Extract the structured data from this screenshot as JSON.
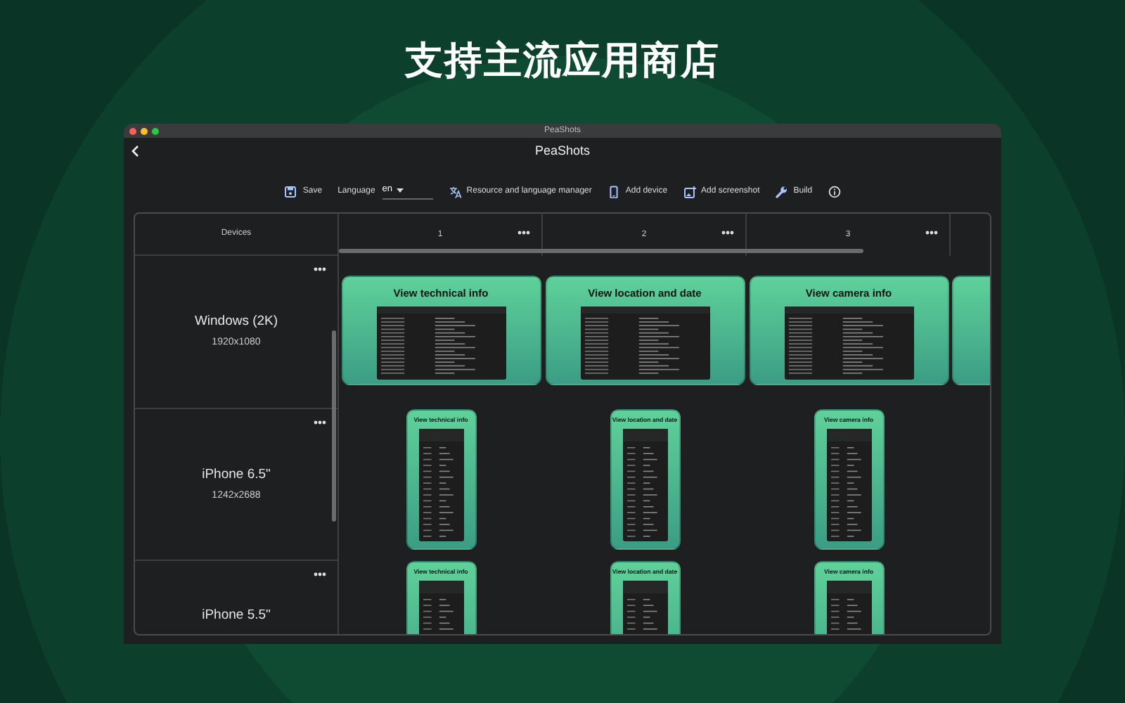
{
  "headline": "支持主流应用商店",
  "window": {
    "title": "PeaShots"
  },
  "header": {
    "title": "PeaShots"
  },
  "toolbar": [
    {
      "kind": "button",
      "label": "Save"
    },
    {
      "kind": "select",
      "label": "Language",
      "value": "en"
    },
    {
      "kind": "button",
      "label": "Resource and language manager"
    },
    {
      "kind": "button",
      "label": "Add device"
    },
    {
      "kind": "button",
      "label": "Add screenshot"
    },
    {
      "kind": "button",
      "label": "Build"
    },
    {
      "kind": "info"
    }
  ],
  "grid": {
    "corner": "Devices",
    "columns": [
      "1",
      "2",
      "3"
    ],
    "rows": [
      {
        "name": "Windows (2K)",
        "resolution": "1920x1080",
        "kind": "landscape",
        "shots": [
          "View technical info",
          "View location and date",
          "View camera info"
        ]
      },
      {
        "name": "iPhone 6.5\"",
        "resolution": "1242x2688",
        "kind": "portrait",
        "shots": [
          "View technical info",
          "View location and date",
          "View camera info"
        ]
      },
      {
        "name": "iPhone 5.5\"",
        "kind": "portrait",
        "shots": [
          "View technical info",
          "View location and date",
          "View camera info"
        ]
      }
    ]
  }
}
